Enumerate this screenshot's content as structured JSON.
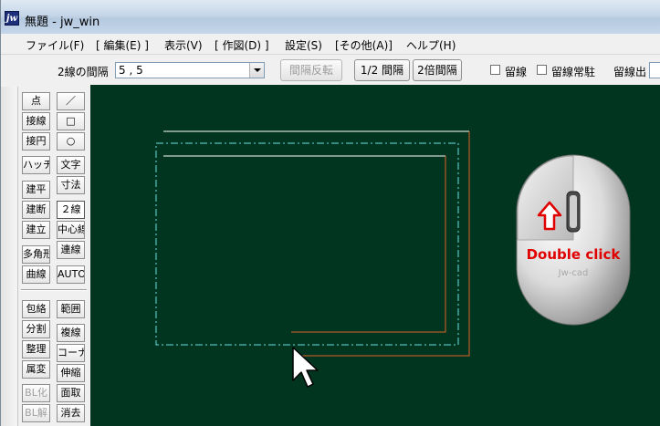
{
  "window": {
    "title": "無題 - jw_win",
    "app_icon": "jw"
  },
  "menu": [
    {
      "id": "file",
      "label": "ファイル(F)"
    },
    {
      "id": "edit",
      "label": "[ 編集(E) ]"
    },
    {
      "id": "view",
      "label": "表示(V)"
    },
    {
      "id": "draw",
      "label": "[ 作図(D) ]"
    },
    {
      "id": "settings",
      "label": "設定(S)"
    },
    {
      "id": "other",
      "label": "[その他(A)]"
    },
    {
      "id": "help",
      "label": "ヘルプ(H)"
    }
  ],
  "toolbar": {
    "spacing_label": "2線の間隔",
    "spacing_value": "5 , 5",
    "reverse_button": "間隔反転",
    "half_button": "1/2 間隔",
    "double_button": "2倍間隔",
    "dome_checkbox": "留線",
    "dome_always_checkbox": "留線常駐",
    "dome_out_label": "留線出"
  },
  "tools_left": [
    "点",
    "接線",
    "接円",
    "ハッチ",
    "建平",
    "建断",
    "建立",
    "多角形",
    "曲線",
    "包絡",
    "分割",
    "整理",
    "属変",
    "BL化",
    "BL解"
  ],
  "tools_right": [
    "／",
    "□",
    "○",
    "文字",
    "寸法",
    "２線",
    "中心線",
    "連線",
    "AUTO",
    "範囲",
    "複線",
    "コーナー",
    "伸縮",
    "面取",
    "消去"
  ],
  "overlay": {
    "mouse_label": "Jw-cad",
    "instruction": "Double click"
  },
  "colors": {
    "canvas_bg": "#013520",
    "white_line": "#ffffff",
    "orange_line": "#e0642a",
    "cyan_line": "#66e0e0",
    "instruction_text": "#e00000"
  }
}
